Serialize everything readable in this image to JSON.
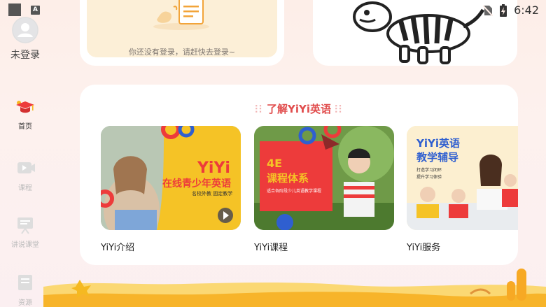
{
  "status_bar": {
    "time": "6:42"
  },
  "sidebar": {
    "login_label": "未登录",
    "items": [
      {
        "label": "首页",
        "active": true,
        "icon": "graduation-cap-icon"
      },
      {
        "label": "课程",
        "active": false,
        "icon": "video-icon"
      },
      {
        "label": "讲说课堂",
        "active": false,
        "icon": "presentation-icon"
      },
      {
        "label": "资源",
        "active": false,
        "icon": "document-icon"
      }
    ]
  },
  "cards": {
    "login_hint": "你还没有登录，请赶快去登录~"
  },
  "section": {
    "title": "了解YiYi英语",
    "tiles": [
      {
        "label": "YiYi介绍",
        "banner_title": "YiYi",
        "banner_sub": "在线青少年英语",
        "banner_tag": "名校外教 固定教学"
      },
      {
        "label": "YiYi课程",
        "banner_title": "4E",
        "banner_sub": "课程体系",
        "banner_tag": "适合各阶段少儿英语教学课程"
      },
      {
        "label": "YiYi服务",
        "banner_title": "YiYi英语",
        "banner_sub": "教学辅导",
        "banner_tag": "打造学习闭环",
        "banner_tag2": "提升学习体验"
      }
    ]
  },
  "colors": {
    "accent": "#e14e4e",
    "brand_yellow": "#f5b921",
    "brand_red": "#ed3b3b",
    "brand_blue": "#2f5fd0"
  }
}
